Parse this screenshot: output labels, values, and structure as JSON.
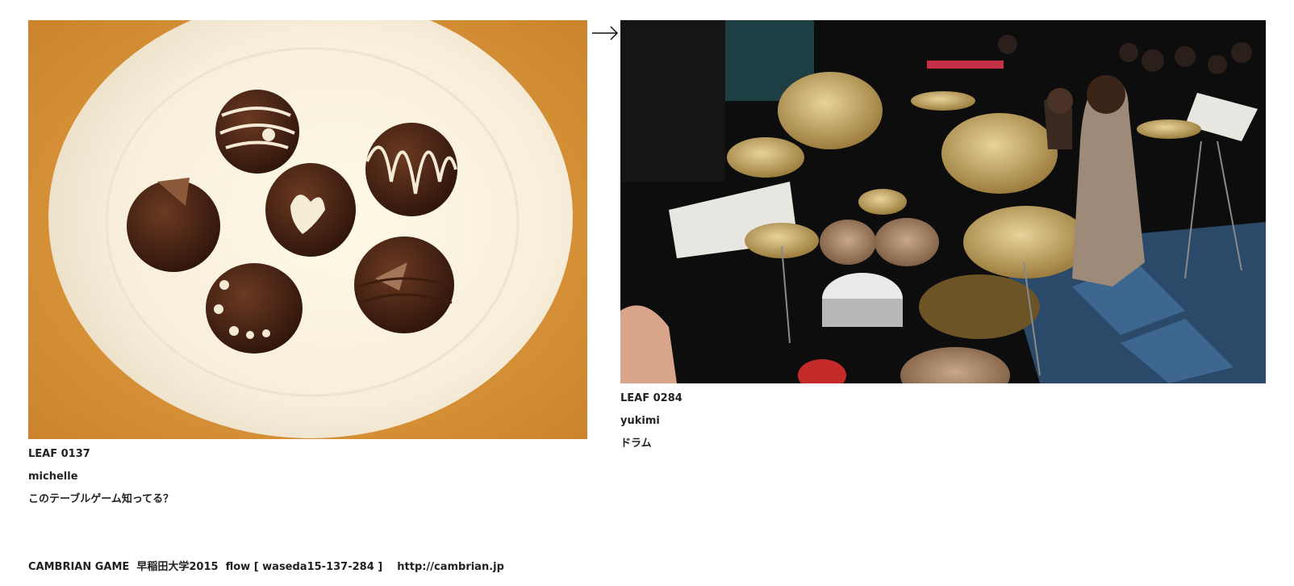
{
  "leaves": [
    {
      "id": "LEAF 0137",
      "author": "michelle",
      "comment": "このテーブルゲーム知ってる？"
    },
    {
      "id": "LEAF 0284",
      "author": "yukimi",
      "comment": "ドラム"
    }
  ],
  "footer": {
    "text": "CAMBRIAN GAME  早稲田大学2015  flow [ waseda15-137-284 ]    http://cambrian.jp"
  },
  "icons": {
    "next": "right-arrow-icon"
  }
}
